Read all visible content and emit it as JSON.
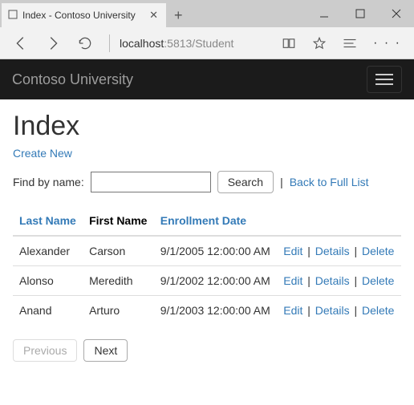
{
  "browser": {
    "tab_title": "Index - Contoso University",
    "url_host": "localhost",
    "url_port_path": ":5813/Student"
  },
  "app": {
    "brand": "Contoso University"
  },
  "page": {
    "heading": "Index",
    "create_link": "Create New",
    "search_label": "Find by name:",
    "search_value": "",
    "search_button": "Search",
    "back_link": "Back to Full List"
  },
  "table": {
    "headers": {
      "last_name": "Last Name",
      "first_name": "First Name",
      "enrollment_date": "Enrollment Date"
    },
    "rows": [
      {
        "last": "Alexander",
        "first": "Carson",
        "date": "9/1/2005 12:00:00 AM"
      },
      {
        "last": "Alonso",
        "first": "Meredith",
        "date": "9/1/2002 12:00:00 AM"
      },
      {
        "last": "Anand",
        "first": "Arturo",
        "date": "9/1/2003 12:00:00 AM"
      }
    ],
    "actions": {
      "edit": "Edit",
      "details": "Details",
      "delete": "Delete"
    }
  },
  "pager": {
    "previous": "Previous",
    "next": "Next"
  }
}
